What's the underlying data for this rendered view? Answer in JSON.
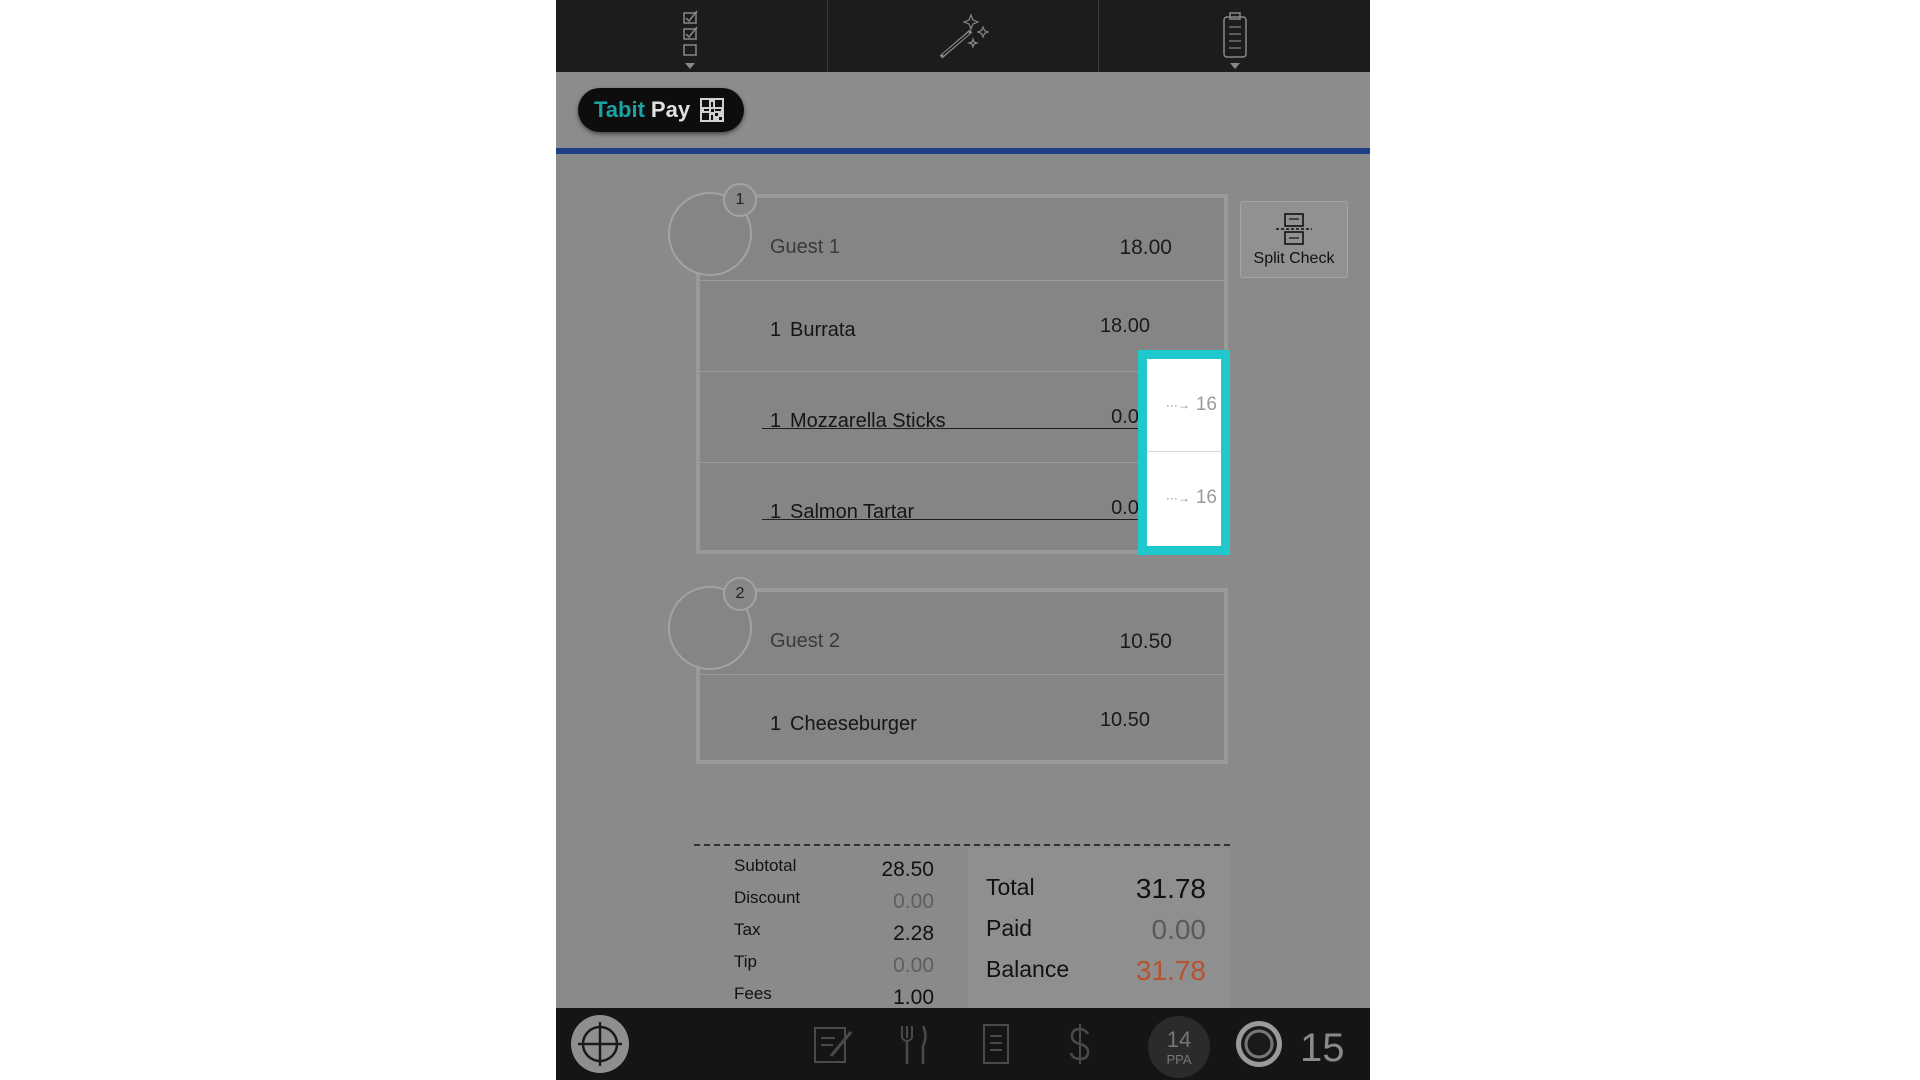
{
  "header": {
    "logo_part1": "Tabit",
    "logo_part2": "Pay"
  },
  "toolbar": {
    "icons": [
      "checklist-icon",
      "magic-wand-icon",
      "clipboard-icon"
    ]
  },
  "split_check": {
    "label": "Split Check"
  },
  "guests": [
    {
      "badge": "1",
      "name": "Guest 1",
      "total": "18.00",
      "items": [
        {
          "qty": "1",
          "name": "Burrata",
          "price": "18.00",
          "voided": false
        },
        {
          "qty": "1",
          "name": "Mozzarella Sticks",
          "price": "0.00",
          "voided": true,
          "moved_to": "16"
        },
        {
          "qty": "1",
          "name": "Salmon Tartar",
          "price": "0.00",
          "voided": true,
          "moved_to": "16"
        }
      ]
    },
    {
      "badge": "2",
      "name": "Guest 2",
      "total": "10.50",
      "items": [
        {
          "qty": "1",
          "name": "Cheeseburger",
          "price": "10.50",
          "voided": false
        }
      ]
    }
  ],
  "highlight": {
    "moved_1": "16",
    "moved_2": "16",
    "arrow": "···→",
    "color": "#1ec8cc"
  },
  "totals": {
    "subtotal_label": "Subtotal",
    "subtotal": "28.50",
    "discount_label": "Discount",
    "discount": "0.00",
    "tax_label": "Tax",
    "tax": "2.28",
    "tip_label": "Tip",
    "tip": "0.00",
    "fees_label": "Fees",
    "fees": "1.00",
    "total_label": "Total",
    "total": "31.78",
    "paid_label": "Paid",
    "paid": "0.00",
    "balance_label": "Balance",
    "balance": "31.78",
    "balance_color": "#b8522e"
  },
  "bottom_bar": {
    "ppa_number": "14",
    "ppa_label": "PPA",
    "table_number": "15"
  }
}
